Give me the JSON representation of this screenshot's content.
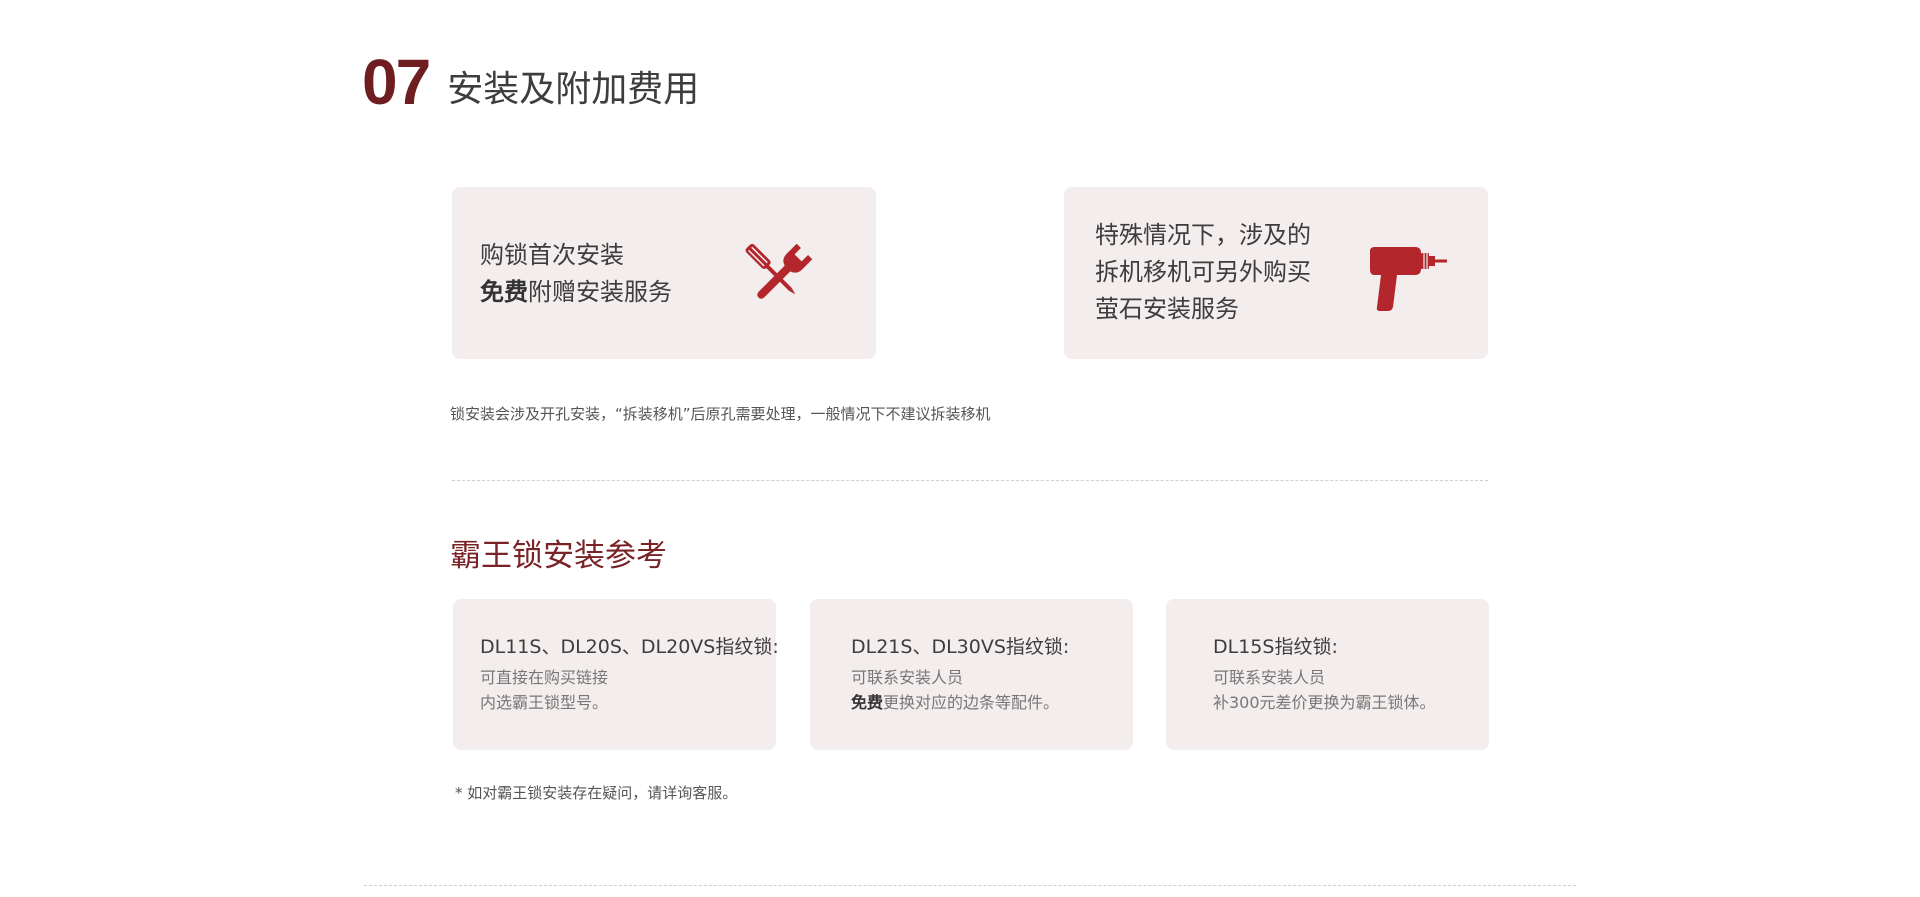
{
  "section": {
    "number": "07",
    "title": "安装及附加费用"
  },
  "cards": [
    {
      "line1": "购锁首次安装",
      "line2_bold": "免费",
      "line2_rest": "附赠安装服务",
      "icon": "wrench-screwdriver-icon"
    },
    {
      "line1": "特殊情况下，涉及的",
      "line2": "拆机移机可另外购买",
      "line3": "萤石安装服务",
      "icon": "drill-icon"
    }
  ],
  "note": "锁安装会涉及开孔安装，“拆装移机”后原孔需要处理，一般情况下不建议拆装移机",
  "bawang": {
    "title": "霸王锁安装参考",
    "items": [
      {
        "title": "DL11S、DL20S、DL20VS指纹锁:",
        "line1": "可直接在购买链接",
        "line2": "内选霸王锁型号。"
      },
      {
        "title": "DL21S、DL30VS指纹锁:",
        "line1": "可联系安装人员",
        "line2_bold": "免费",
        "line2_rest": "更换对应的边条等配件。"
      },
      {
        "title": "DL15S指纹锁:",
        "line1": "可联系安装人员",
        "line2": "补300元差价更换为霸王锁体。"
      }
    ],
    "footnote": "* 如对霸王锁安装存在疑问，请详询客服。"
  },
  "colors": {
    "accent": "#6e1d20",
    "icon_red": "#b3262b",
    "card_bg": "#f3eded"
  }
}
